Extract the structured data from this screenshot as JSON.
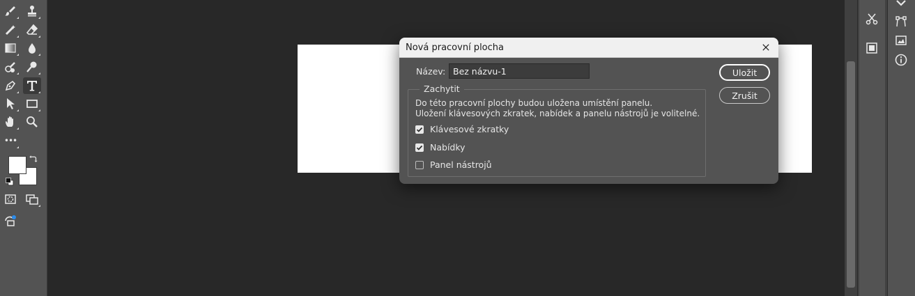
{
  "dialog": {
    "title": "Nová pracovní plocha",
    "name_label": "Název:",
    "name_value": "Bez názvu-1",
    "save_button": "Uložit",
    "cancel_button": "Zrušit",
    "group_title": "Zachytit",
    "description_line1": "Do této pracovní plochy budou uložena umístění panelu.",
    "description_line2": "Uložení klávesových zkratek, nabídek a panelu nástrojů je volitelné.",
    "checkboxes": [
      {
        "label": "Klávesové zkratky",
        "checked": true
      },
      {
        "label": "Nabídky",
        "checked": true
      },
      {
        "label": "Panel nástrojů",
        "checked": false
      }
    ]
  },
  "toolbar": {
    "more_tools": "•••",
    "tools": [
      "brush-icon",
      "stamp-icon",
      "healing-icon",
      "eraser-icon",
      "gradient-icon",
      "blur-icon",
      "dodge-icon",
      "burn-icon",
      "pen-icon",
      "type-icon",
      "path-select-icon",
      "rectangle-icon",
      "hand-icon",
      "zoom-icon"
    ],
    "foreground_color": "#ffffff",
    "background_color": "#ffffff"
  },
  "colors": {
    "app_background": "#282828",
    "panel": "#535353",
    "canvas": "#ffffff",
    "dialog_titlebar": "#f0f0f0"
  }
}
